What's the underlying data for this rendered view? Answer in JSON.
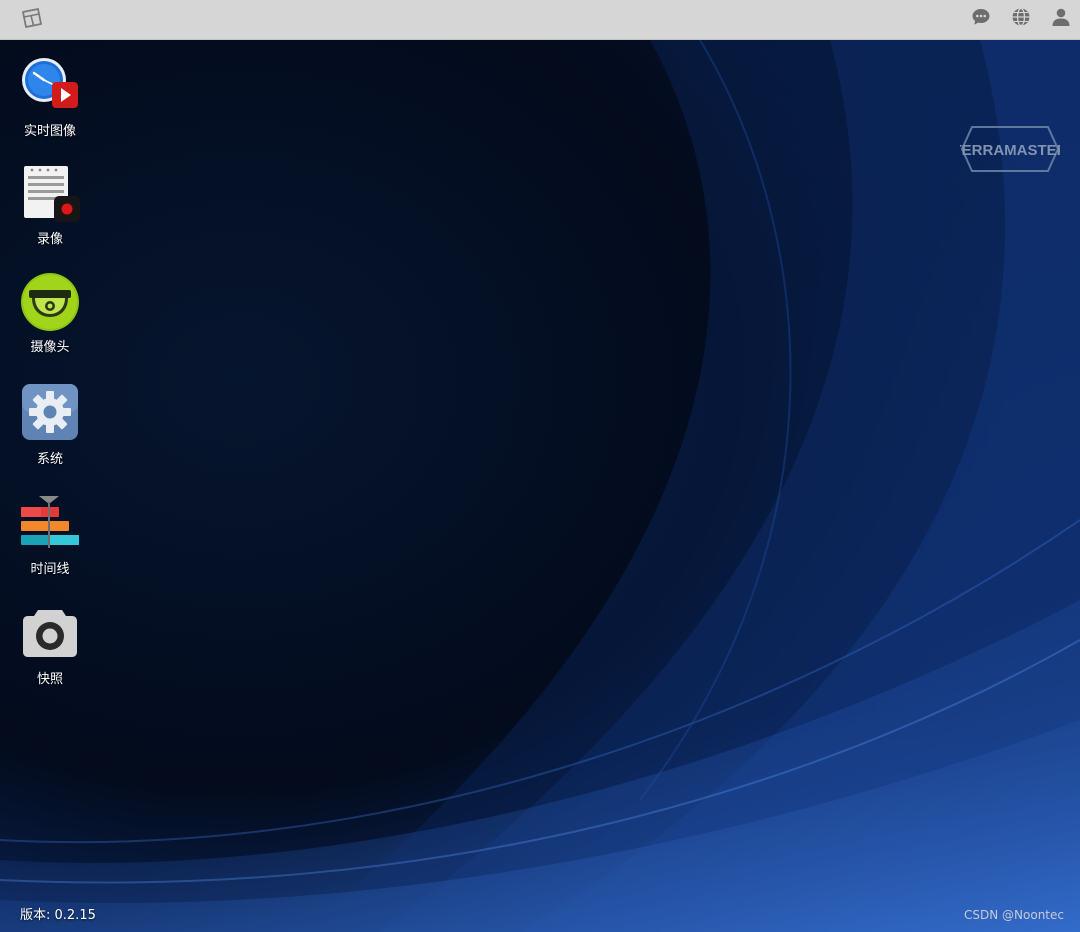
{
  "taskbar": {
    "start_icon": "window-icon",
    "right_icons": [
      "chat-icon",
      "globe-icon",
      "user-icon"
    ]
  },
  "desktop": {
    "items": [
      {
        "label": "实时图像",
        "icon": "live-view-icon"
      },
      {
        "label": "录像",
        "icon": "recording-icon"
      },
      {
        "label": "摄像头",
        "icon": "camera-dome-icon"
      },
      {
        "label": "系统",
        "icon": "settings-gear-icon"
      },
      {
        "label": "时间线",
        "icon": "timeline-icon"
      },
      {
        "label": "快照",
        "icon": "snapshot-camera-icon"
      }
    ],
    "brand": "TERRAMASTER"
  },
  "footer": {
    "version": "版本: 0.2.15",
    "watermark": "CSDN @Noontec"
  },
  "colors": {
    "taskbar_bg": "#d6d6d6",
    "desktop_dark": "#030b1c",
    "desktop_accent": "#4b91ff"
  }
}
